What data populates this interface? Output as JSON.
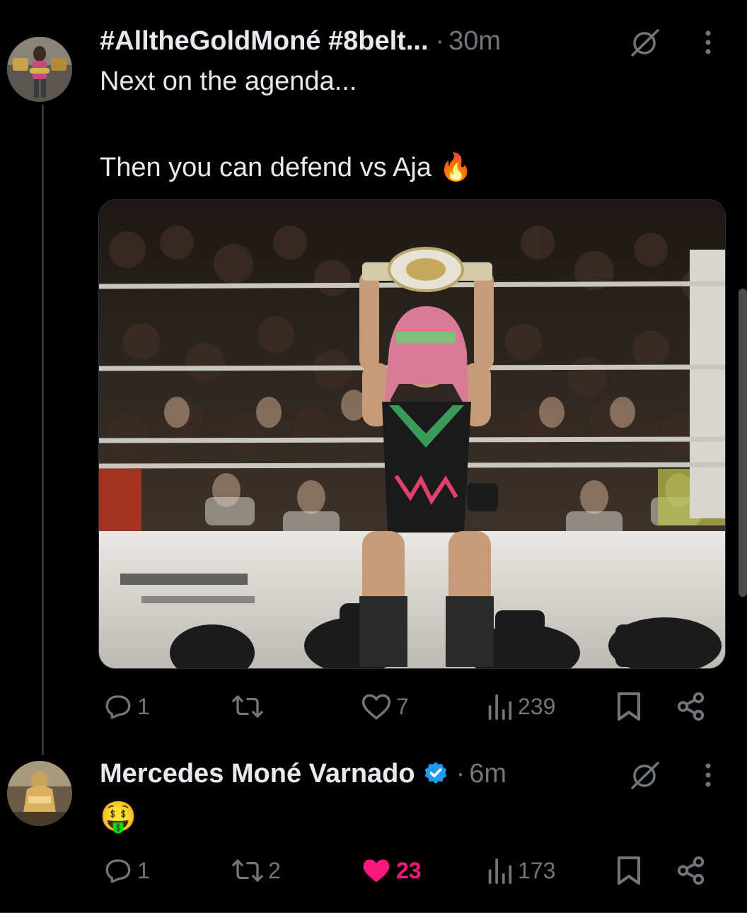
{
  "tweets": [
    {
      "display_name": "#AlltheGoldMoné #8belt...",
      "time": "30m",
      "text_line1": "Next on the agenda...",
      "text_line2": "Then you can defend vs Aja",
      "emoji": "🔥",
      "actions": {
        "replies": "1",
        "reposts": "",
        "likes": "7",
        "views": "239"
      }
    },
    {
      "display_name": "Mercedes Moné Varnado",
      "time": "6m",
      "text": "🤑",
      "actions": {
        "replies": "1",
        "reposts": "2",
        "likes": "23",
        "views": "173"
      }
    }
  ],
  "colors": {
    "background": "#000000",
    "text": "#e7e9ea",
    "muted": "#71767b",
    "verified": "#1d9bf0",
    "like_active": "#f91880"
  }
}
